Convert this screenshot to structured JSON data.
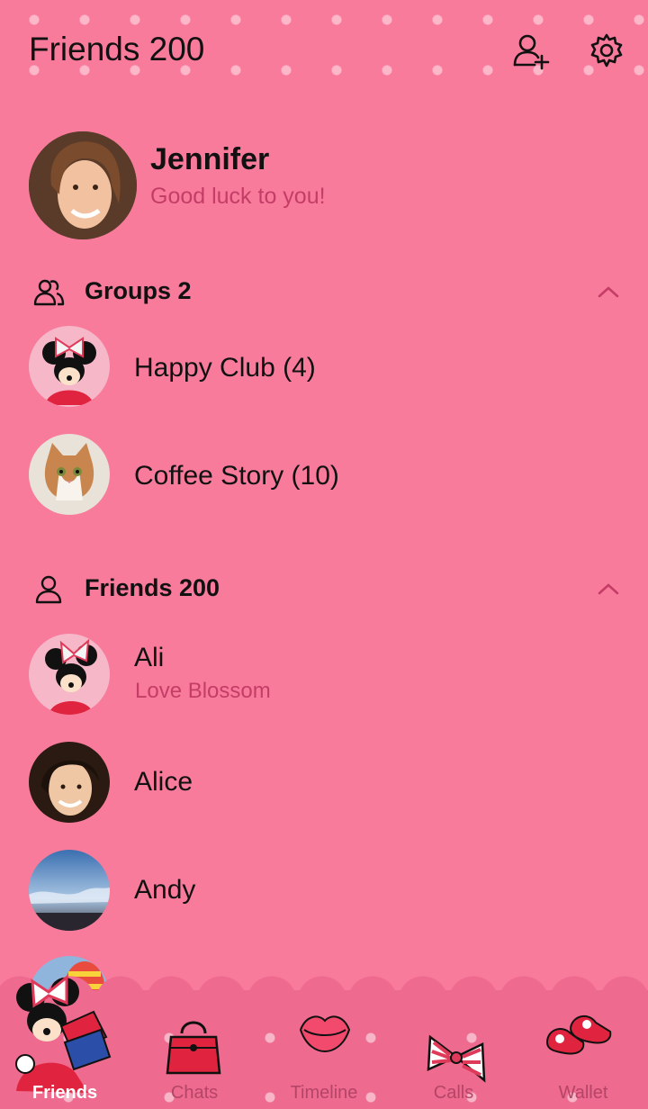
{
  "header": {
    "title": "Friends 200"
  },
  "profile": {
    "name": "Jennifer",
    "status": "Good luck to you!"
  },
  "groups": {
    "label": "Groups 2",
    "items": [
      {
        "name": "Happy Club (4)"
      },
      {
        "name": "Coffee Story (10)"
      }
    ]
  },
  "friends": {
    "label": "Friends 200",
    "items": [
      {
        "name": "Ali",
        "status": "Love Blossom"
      },
      {
        "name": "Alice"
      },
      {
        "name": "Andy"
      }
    ]
  },
  "tabs": [
    {
      "label": "Friends",
      "icon": "minnie-icon",
      "active": true
    },
    {
      "label": "Chats",
      "icon": "handbag-icon"
    },
    {
      "label": "Timeline",
      "icon": "lips-icon"
    },
    {
      "label": "Calls",
      "icon": "bow-icon"
    },
    {
      "label": "Wallet",
      "icon": "shoes-icon"
    }
  ],
  "colors": {
    "background": "#f97b9c",
    "accent_text": "#c43d66",
    "nav": "#ee6a8e"
  }
}
